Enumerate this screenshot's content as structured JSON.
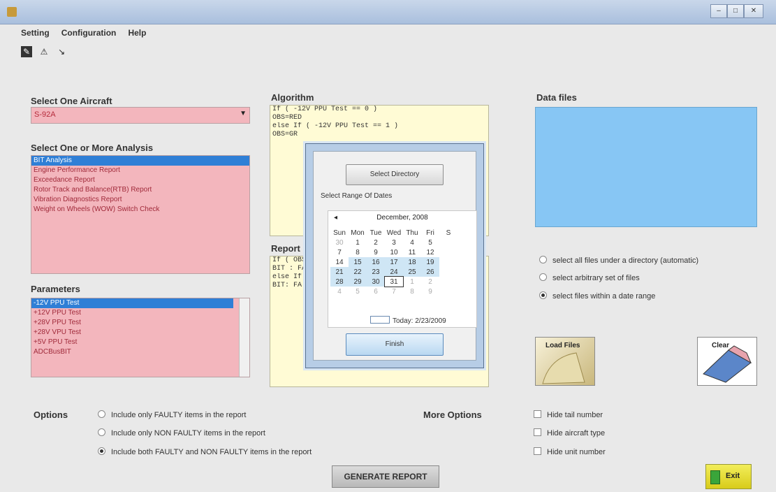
{
  "window": {
    "buttons": [
      "–",
      "□",
      "✕"
    ]
  },
  "menu": [
    "Setting",
    "Configuration",
    "Help"
  ],
  "aircraft": {
    "label": "Select One Aircraft",
    "value": "S-92A"
  },
  "analysis": {
    "label": "Select One or More Analysis",
    "items": [
      "BIT Analysis",
      "Engine Performance Report",
      "Exceedance Report",
      "Rotor Track and Balance(RTB) Report",
      "Vibration Diagnostics Report",
      "Weight on Wheels (WOW) Switch Check"
    ]
  },
  "parameters": {
    "label": "Parameters",
    "items": [
      "-12V PPU Test",
      "+12V PPU Test",
      "+28V PPU Test",
      "+28V VPU Test",
      "+5V PPU Test",
      "ADCBusBIT"
    ]
  },
  "algorithm": {
    "label": "Algorithm",
    "lines": [
      "If ( -12V PPU Test == 0 )",
      "  OBS=RED",
      "else If ( -12V PPU Test == 1 )",
      "  OBS=GR"
    ]
  },
  "report": {
    "label": "Report",
    "lines": [
      "If ( OBS",
      "  BIT : FA",
      "else If (",
      "  BIT: FA"
    ]
  },
  "datafiles": {
    "label": "Data files",
    "options": [
      "select all files under a directory (automatic)",
      "select arbitrary set of files",
      "select files within a date range"
    ],
    "selected": 2
  },
  "buttons": {
    "load": "Load Files",
    "clear": "Clear",
    "generate": "GENERATE REPORT",
    "exit": "Exit"
  },
  "options": {
    "label": "Options",
    "items": [
      "Include only FAULTY items in the report",
      "Include only NON FAULTY items in the report",
      "Include both FAULTY and NON FAULTY items in the report"
    ],
    "selected": 2
  },
  "more_options": {
    "label": "More Options",
    "items": [
      "Hide tail number",
      "Hide aircraft type",
      "Hide unit number"
    ]
  },
  "dialog": {
    "select_directory": "Select Directory",
    "range_label": "Select Range Of Dates",
    "month": "December, 2008",
    "prev": "◂",
    "days": [
      "Sun",
      "Mon",
      "Tue",
      "Wed",
      "Thu",
      "Fri",
      "S"
    ],
    "weeks": [
      [
        "30",
        "1",
        "2",
        "3",
        "4",
        "5",
        ""
      ],
      [
        "7",
        "8",
        "9",
        "10",
        "11",
        "12",
        ""
      ],
      [
        "14",
        "15",
        "16",
        "17",
        "18",
        "19",
        ""
      ],
      [
        "21",
        "22",
        "23",
        "24",
        "25",
        "26",
        ""
      ],
      [
        "28",
        "29",
        "30",
        "31",
        "1",
        "2",
        ""
      ],
      [
        "4",
        "5",
        "6",
        "7",
        "8",
        "9",
        ""
      ]
    ],
    "today": "Today: 2/23/2009",
    "finish": "Finish"
  }
}
